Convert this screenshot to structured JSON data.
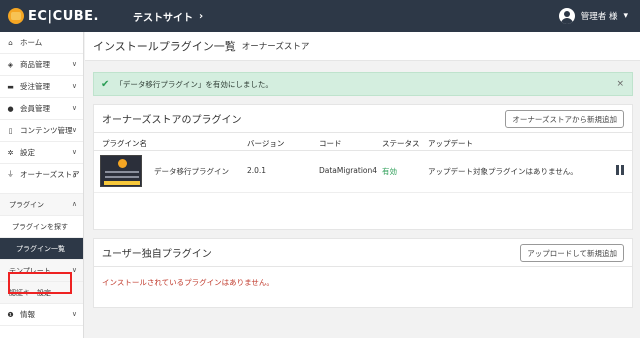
{
  "topbar": {
    "logo_text": "EC|CUBE.",
    "site_name": "テストサイト",
    "site_chevron": "›",
    "user_name": "管理者 様",
    "user_caret": "▾"
  },
  "sidebar": {
    "items": [
      {
        "label": "ホーム",
        "icon": "home-icon",
        "glyph": "⌂"
      },
      {
        "label": "商品管理",
        "icon": "product-icon",
        "glyph": "◈",
        "chev": "∨"
      },
      {
        "label": "受注管理",
        "icon": "cart-icon",
        "glyph": "▬",
        "chev": "∨"
      },
      {
        "label": "会員管理",
        "icon": "users-icon",
        "glyph": "●",
        "chev": "∨"
      },
      {
        "label": "コンテンツ管理",
        "icon": "file-icon",
        "glyph": "▯",
        "chev": "∨"
      },
      {
        "label": "設定",
        "icon": "gear-icon",
        "glyph": "✲",
        "chev": "∨"
      },
      {
        "label": "オーナーズストア",
        "icon": "plug-icon",
        "glyph": "⏚",
        "chev": "∧"
      }
    ],
    "plugin_group": {
      "label": "プラグイン",
      "chev": "∧"
    },
    "plugin_find": "プラグインを探す",
    "plugin_list": "プラグイン一覧",
    "template": {
      "label": "テンプレート",
      "chev": "∨"
    },
    "auth_key": "認証キー設定",
    "info": {
      "label": "情報",
      "icon": "info-icon",
      "glyph": "❶",
      "chev": "∨"
    }
  },
  "header": {
    "title": "インストールプラグイン一覧",
    "subtitle": "オーナーズストア"
  },
  "alert": {
    "icon": "✔",
    "message": "「データ移行プラグイン」を有効にしました。",
    "close": "×"
  },
  "store_section": {
    "title": "オーナーズストアのプラグイン",
    "add_button": "オーナーズストアから新規追加",
    "columns": [
      "プラグイン名",
      "バージョン",
      "コード",
      "ステータス",
      "アップデート"
    ],
    "rows": [
      {
        "name": "データ移行プラグイン",
        "version": "2.0.1",
        "code": "DataMigration4",
        "status": "有効",
        "update": "アップデート対象プラグインはありません。"
      }
    ]
  },
  "user_section": {
    "title": "ユーザー独自プラグイン",
    "upload_button": "アップロードして新規追加",
    "empty_message": "インストールされているプラグインはありません。"
  }
}
